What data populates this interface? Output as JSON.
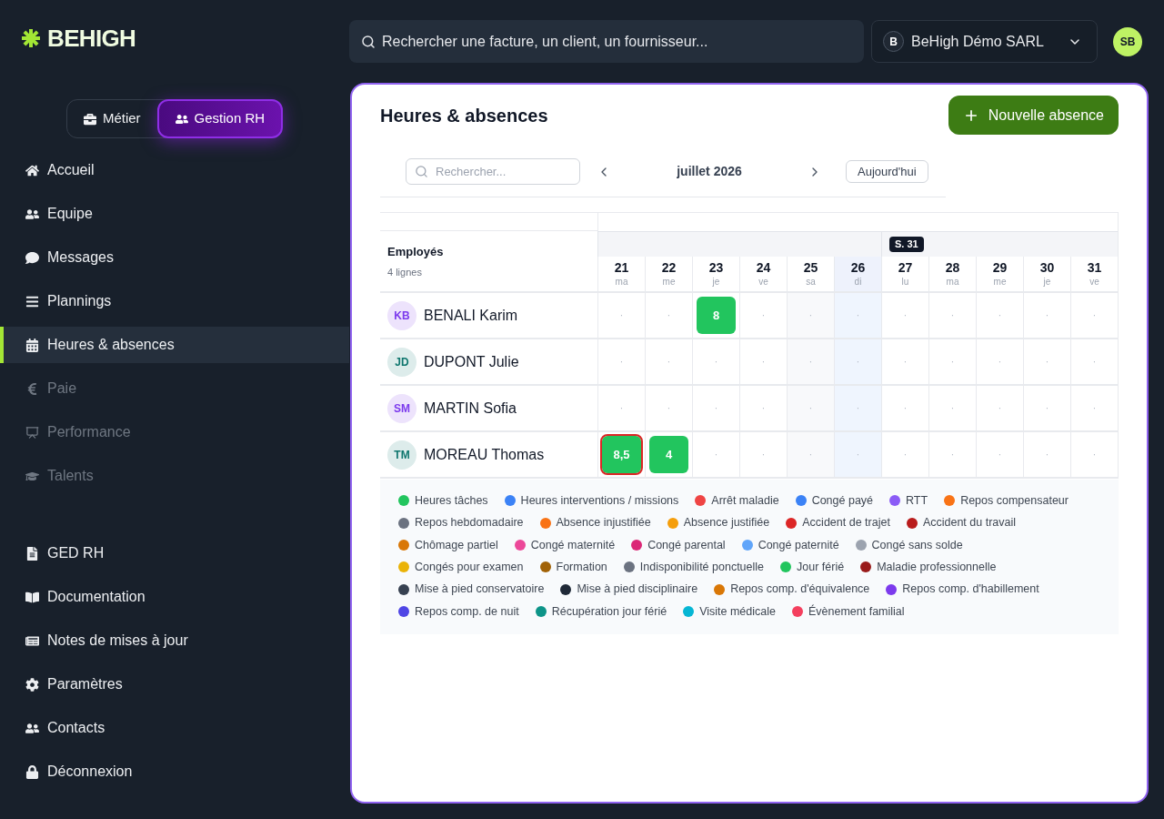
{
  "brand": {
    "name": "BEHIGH"
  },
  "mode_switch": [
    {
      "label": "Métier",
      "selected": false
    },
    {
      "label": "Gestion RH",
      "selected": true
    }
  ],
  "nav": {
    "main": [
      {
        "label": "Accueil",
        "selected": false,
        "disabled": false
      },
      {
        "label": "Equipe",
        "selected": false,
        "disabled": false
      },
      {
        "label": "Messages",
        "selected": false,
        "disabled": false
      },
      {
        "label": "Plannings",
        "selected": false,
        "disabled": false
      },
      {
        "label": "Heures & absences",
        "selected": true,
        "disabled": false
      },
      {
        "label": "Paie",
        "selected": false,
        "disabled": true
      },
      {
        "label": "Performance",
        "selected": false,
        "disabled": true
      },
      {
        "label": "Talents",
        "selected": false,
        "disabled": true
      }
    ],
    "secondary": [
      {
        "label": "GED RH",
        "selected": false,
        "disabled": false
      },
      {
        "label": "Documentation",
        "selected": false,
        "disabled": false
      },
      {
        "label": "Notes de mises à jour",
        "selected": false,
        "disabled": false
      },
      {
        "label": "Paramètres",
        "selected": false,
        "disabled": false
      },
      {
        "label": "Contacts",
        "selected": false,
        "disabled": false
      },
      {
        "label": "Déconnexion",
        "selected": false,
        "disabled": false
      }
    ]
  },
  "search": {
    "placeholder": "Rechercher une facture, un client, un fournisseur..."
  },
  "company_selector": {
    "initial": "B",
    "name": "BeHigh Démo SARL"
  },
  "user_avatar": {
    "initials": "SB"
  },
  "page": {
    "title": "Heures & absences",
    "new_button": {
      "label": "Nouvelle absence"
    },
    "toolbar": {
      "search": {
        "placeholder": "Rechercher..."
      },
      "month": "juillet 2026",
      "today_button": "Aujourd'hui"
    },
    "table": {
      "employee_header": "Employés",
      "row_count": "4 lignes",
      "days": [
        {
          "number": "21",
          "weekday": "ma",
          "kind": "workday"
        },
        {
          "number": "22",
          "weekday": "me",
          "kind": "workday"
        },
        {
          "number": "23",
          "weekday": "je",
          "kind": "workday"
        },
        {
          "number": "24",
          "weekday": "ve",
          "kind": "workday"
        },
        {
          "number": "25",
          "weekday": "sa",
          "kind": "weekend"
        },
        {
          "number": "26",
          "weekday": "di",
          "kind": "highlighted"
        },
        {
          "number": "27",
          "weekday": "lu",
          "kind": "workday",
          "week_badge": "S. 31"
        },
        {
          "number": "28",
          "weekday": "ma",
          "kind": "workday"
        },
        {
          "number": "29",
          "weekday": "me",
          "kind": "workday"
        },
        {
          "number": "30",
          "weekday": "je",
          "kind": "workday"
        },
        {
          "number": "31",
          "weekday": "ve",
          "kind": "workday"
        }
      ],
      "rows": [
        {
          "initials": "KB",
          "name": "BENALI Karim",
          "color": "#7c3aed",
          "cells": [
            {
              "kind": "empty",
              "text": "·",
              "selected": false
            },
            {
              "kind": "empty",
              "text": "·",
              "selected": false
            },
            {
              "kind": "entry",
              "text": "8",
              "color": "#22c55e",
              "selected": false
            },
            {
              "kind": "empty",
              "text": "·",
              "selected": false
            },
            {
              "kind": "empty",
              "text": "·",
              "selected": false
            },
            {
              "kind": "empty",
              "text": "·",
              "selected": false
            },
            {
              "kind": "empty",
              "text": "·",
              "selected": false
            },
            {
              "kind": "empty",
              "text": "·",
              "selected": false
            },
            {
              "kind": "empty",
              "text": "·",
              "selected": false
            },
            {
              "kind": "empty",
              "text": "·",
              "selected": false
            },
            {
              "kind": "empty",
              "text": "·",
              "selected": false
            }
          ]
        },
        {
          "initials": "JD",
          "name": "DUPONT Julie",
          "color": "#0f766e",
          "cells": [
            {
              "kind": "empty",
              "text": "·",
              "selected": false
            },
            {
              "kind": "empty",
              "text": "·",
              "selected": false
            },
            {
              "kind": "empty",
              "text": "·",
              "selected": false
            },
            {
              "kind": "empty",
              "text": "·",
              "selected": false
            },
            {
              "kind": "empty",
              "text": "·",
              "selected": false
            },
            {
              "kind": "empty",
              "text": "·",
              "selected": false
            },
            {
              "kind": "empty",
              "text": "·",
              "selected": false
            },
            {
              "kind": "empty",
              "text": "·",
              "selected": false
            },
            {
              "kind": "empty",
              "text": "·",
              "selected": false
            },
            {
              "kind": "empty",
              "text": "·",
              "selected": false
            },
            {
              "kind": "empty",
              "text": "·",
              "selected": false
            }
          ]
        },
        {
          "initials": "SM",
          "name": "MARTIN Sofia",
          "color": "#7c3aed",
          "cells": [
            {
              "kind": "empty",
              "text": "·",
              "selected": false
            },
            {
              "kind": "empty",
              "text": "·",
              "selected": false
            },
            {
              "kind": "empty",
              "text": "·",
              "selected": false
            },
            {
              "kind": "empty",
              "text": "·",
              "selected": false
            },
            {
              "kind": "empty",
              "text": "·",
              "selected": false
            },
            {
              "kind": "empty",
              "text": "·",
              "selected": false
            },
            {
              "kind": "empty",
              "text": "·",
              "selected": false
            },
            {
              "kind": "empty",
              "text": "·",
              "selected": false
            },
            {
              "kind": "empty",
              "text": "·",
              "selected": false
            },
            {
              "kind": "empty",
              "text": "·",
              "selected": false
            },
            {
              "kind": "empty",
              "text": "·",
              "selected": false
            }
          ]
        },
        {
          "initials": "TM",
          "name": "MOREAU Thomas",
          "color": "#0f766e",
          "cells": [
            {
              "kind": "entry",
              "text": "8,5",
              "color": "#22c55e",
              "selected": true
            },
            {
              "kind": "entry",
              "text": "4",
              "color": "#22c55e",
              "selected": false
            },
            {
              "kind": "empty",
              "text": "·",
              "selected": false
            },
            {
              "kind": "empty",
              "text": "·",
              "selected": false
            },
            {
              "kind": "empty",
              "text": "·",
              "selected": false
            },
            {
              "kind": "empty",
              "text": "·",
              "selected": false
            },
            {
              "kind": "empty",
              "text": "·",
              "selected": false
            },
            {
              "kind": "empty",
              "text": "·",
              "selected": false
            },
            {
              "kind": "empty",
              "text": "·",
              "selected": false
            },
            {
              "kind": "empty",
              "text": "·",
              "selected": false
            },
            {
              "kind": "empty",
              "text": "·",
              "selected": false
            }
          ]
        }
      ]
    },
    "legend": {
      "items": [
        {
          "label": "Heures tâches",
          "color": "#22c55e"
        },
        {
          "label": "Heures interventions / missions",
          "color": "#3b82f6"
        },
        {
          "label": "Arrêt maladie",
          "color": "#ef4444"
        },
        {
          "label": "Congé payé",
          "color": "#3b82f6"
        },
        {
          "label": "RTT",
          "color": "#8b5cf6"
        },
        {
          "label": "Repos compensateur",
          "color": "#f97316"
        },
        {
          "label": "Repos hebdomadaire",
          "color": "#6b7280"
        },
        {
          "label": "Absence injustifiée",
          "color": "#f97316"
        },
        {
          "label": "Absence justifiée",
          "color": "#f59e0b"
        },
        {
          "label": "Accident de trajet",
          "color": "#dc2626"
        },
        {
          "label": "Accident du travail",
          "color": "#b91c1c"
        },
        {
          "label": "Chômage partiel",
          "color": "#d97706"
        },
        {
          "label": "Congé maternité",
          "color": "#ec4899"
        },
        {
          "label": "Congé parental",
          "color": "#db2777"
        },
        {
          "label": "Congé paternité",
          "color": "#60a5fa"
        },
        {
          "label": "Congé sans solde",
          "color": "#9ca3af"
        },
        {
          "label": "Congés pour examen",
          "color": "#eab308"
        },
        {
          "label": "Formation",
          "color": "#a16207"
        },
        {
          "label": "Indisponibilité ponctuelle",
          "color": "#6b7280"
        },
        {
          "label": "Jour férié",
          "color": "#22c55e"
        },
        {
          "label": "Maladie professionnelle",
          "color": "#991b1b"
        },
        {
          "label": "Mise à pied conservatoire",
          "color": "#374151"
        },
        {
          "label": "Mise à pied disciplinaire",
          "color": "#1f2937"
        },
        {
          "label": "Repos comp. d'équivalence",
          "color": "#d97706"
        },
        {
          "label": "Repos comp. d'habillement",
          "color": "#7c3aed"
        },
        {
          "label": "Repos comp. de nuit",
          "color": "#4f46e5"
        },
        {
          "label": "Récupération jour férié",
          "color": "#0d9488"
        },
        {
          "label": "Visite médicale",
          "color": "#06b6d4"
        },
        {
          "label": "Évènement familial",
          "color": "#f43f5e"
        }
      ]
    }
  }
}
